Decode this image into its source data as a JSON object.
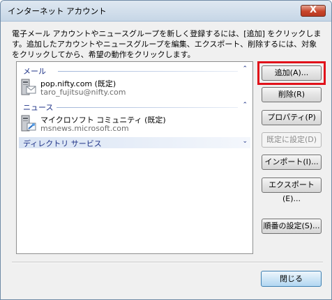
{
  "window": {
    "title": "インターネット アカウント",
    "close_glyph": "X"
  },
  "description": "電子メール アカウントやニュースグループを新しく登録するには、[追加] をクリックします。追加したアカウントやニュースグループを編集、エクスポート、削除するには、対象をクリックしてから、希望の動作をクリックします。",
  "accounts_list": {
    "groups": [
      {
        "label": "メール",
        "chevron": "⌃"
      },
      {
        "label": "ニュース",
        "chevron": "⌃"
      },
      {
        "label": "ディレクトリ サービス",
        "chevron": "⌄"
      }
    ],
    "mail_account": {
      "name": "pop.nifty.com (既定)",
      "address": "taro_fujitsu@nifty.com"
    },
    "news_account": {
      "name": "マイクロソフト コミュニティ (既定)",
      "server": "msnews.microsoft.com"
    }
  },
  "buttons": {
    "add": "追加(A)...",
    "remove": "削除(R)",
    "properties": "プロパティ(P)",
    "set_default": "既定に設定(D)",
    "import": "インポート(I)...",
    "export": "エクスポート(E)...",
    "order": "順番の設定(S)...",
    "close": "閉じる"
  },
  "colors": {
    "highlight": "#e1111a",
    "group_header_text": "#1e3287"
  }
}
